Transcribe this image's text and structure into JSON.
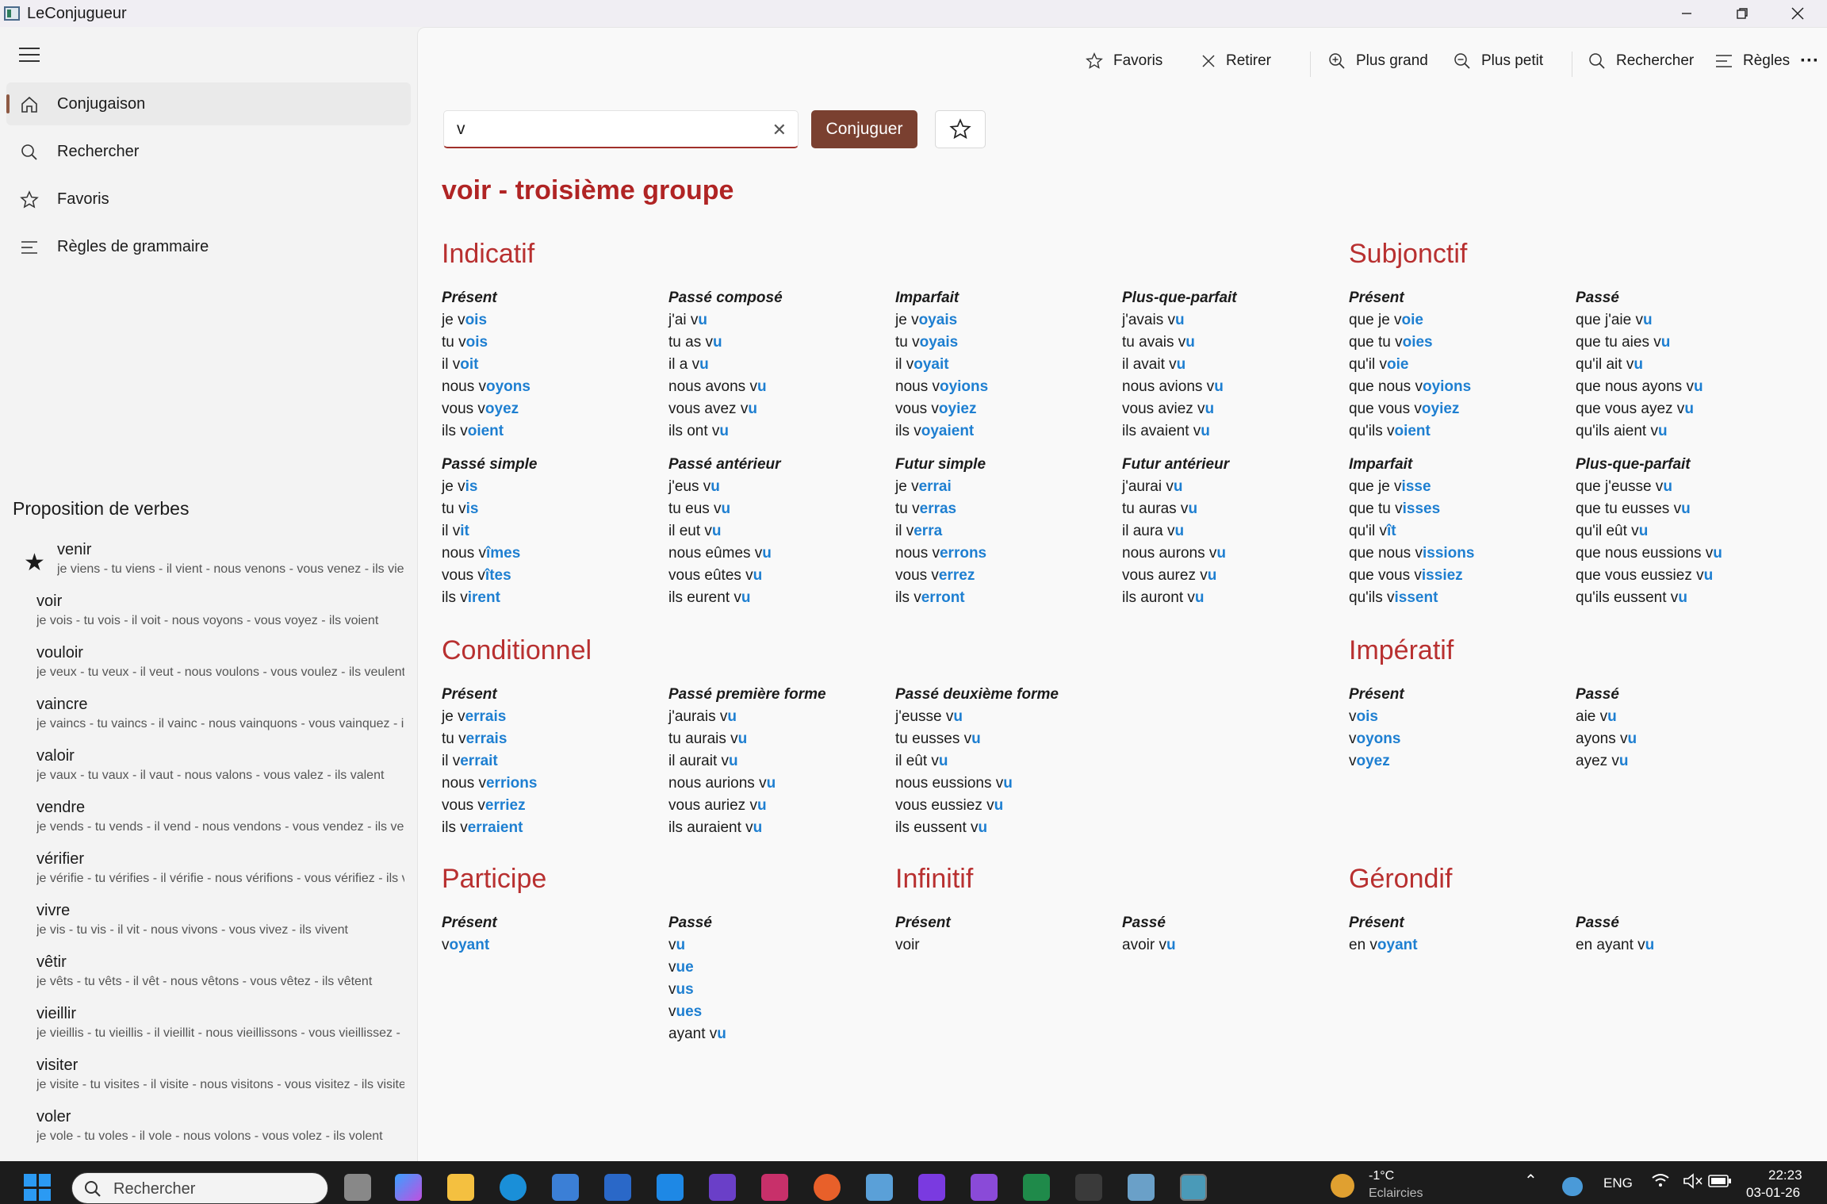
{
  "window": {
    "title": "LeConjugueur"
  },
  "nav": [
    {
      "label": "Conjugaison",
      "icon": "home-icon"
    },
    {
      "label": "Rechercher",
      "icon": "search-icon"
    },
    {
      "label": "Favoris",
      "icon": "star-icon"
    },
    {
      "label": "Règles de grammaire",
      "icon": "list-icon"
    }
  ],
  "suggestions": {
    "title": "Proposition de verbes",
    "items": [
      {
        "verb": "venir",
        "conj": "je viens - tu viens - il vient - nous venons - vous venez - ils viennent",
        "favorite": true
      },
      {
        "verb": "voir",
        "conj": "je vois - tu vois - il voit - nous voyons - vous voyez - ils voient"
      },
      {
        "verb": "vouloir",
        "conj": "je veux - tu veux - il veut - nous voulons - vous voulez - ils veulent"
      },
      {
        "verb": "vaincre",
        "conj": "je vaincs - tu vaincs - il vainc - nous vainquons - vous vainquez - ils vainquent"
      },
      {
        "verb": "valoir",
        "conj": "je vaux - tu vaux - il vaut - nous valons - vous valez - ils valent"
      },
      {
        "verb": "vendre",
        "conj": "je vends - tu vends - il vend - nous vendons - vous vendez - ils vendent"
      },
      {
        "verb": "vérifier",
        "conj": "je vérifie - tu vérifies - il vérifie - nous vérifions - vous vérifiez - ils vérifient"
      },
      {
        "verb": "vivre",
        "conj": "je vis - tu vis - il vit - nous vivons - vous vivez - ils vivent"
      },
      {
        "verb": "vêtir",
        "conj": "je vêts - tu vêts - il vêt - nous vêtons - vous vêtez - ils vêtent"
      },
      {
        "verb": "vieillir",
        "conj": "je vieillis - tu vieillis - il vieillit - nous vieillissons - vous vieillissez - ils vieillissent"
      },
      {
        "verb": "visiter",
        "conj": "je visite - tu visites - il visite - nous visitons - vous visitez - ils visitent"
      },
      {
        "verb": "voler",
        "conj": "je vole - tu voles - il vole - nous volons - vous volez - ils volent"
      }
    ]
  },
  "toolbar": {
    "favoris": "Favoris",
    "retirer": "Retirer",
    "plus_grand": "Plus grand",
    "plus_petit": "Plus petit",
    "rechercher": "Rechercher",
    "regles": "Règles",
    "more": "···"
  },
  "search": {
    "value": "v",
    "button": "Conjuguer"
  },
  "verb_title": "voir - troisième groupe",
  "sections": {
    "indicatif": "Indicatif",
    "subjonctif": "Subjonctif",
    "conditionnel": "Conditionnel",
    "imperatif": "Impératif",
    "participe": "Participe",
    "infinitif": "Infinitif",
    "gerondif": "Gérondif"
  },
  "tenses": [
    {
      "name": "Présent",
      "lines": [
        [
          "je v",
          "ois"
        ],
        [
          "tu v",
          "ois"
        ],
        [
          "il v",
          "oit"
        ],
        [
          "nous v",
          "oyons"
        ],
        [
          "vous v",
          "oyez"
        ],
        [
          "ils v",
          "oient"
        ]
      ]
    },
    {
      "name": "Passé composé",
      "lines": [
        [
          "j'ai v",
          "u"
        ],
        [
          "tu as v",
          "u"
        ],
        [
          "il a v",
          "u"
        ],
        [
          "nous avons v",
          "u"
        ],
        [
          "vous avez v",
          "u"
        ],
        [
          "ils ont v",
          "u"
        ]
      ]
    },
    {
      "name": "Imparfait",
      "lines": [
        [
          "je v",
          "oyais"
        ],
        [
          "tu v",
          "oyais"
        ],
        [
          "il v",
          "oyait"
        ],
        [
          "nous v",
          "oyions"
        ],
        [
          "vous v",
          "oyiez"
        ],
        [
          "ils v",
          "oyaient"
        ]
      ]
    },
    {
      "name": "Plus-que-parfait",
      "lines": [
        [
          "j'avais v",
          "u"
        ],
        [
          "tu avais v",
          "u"
        ],
        [
          "il avait v",
          "u"
        ],
        [
          "nous avions v",
          "u"
        ],
        [
          "vous aviez v",
          "u"
        ],
        [
          "ils avaient v",
          "u"
        ]
      ]
    },
    {
      "name": "Présent",
      "lines": [
        [
          "que je v",
          "oie"
        ],
        [
          "que tu v",
          "oies"
        ],
        [
          "qu'il v",
          "oie"
        ],
        [
          "que nous v",
          "oyions"
        ],
        [
          "que vous v",
          "oyiez"
        ],
        [
          "qu'ils v",
          "oient"
        ]
      ]
    },
    {
      "name": "Passé",
      "lines": [
        [
          "que j'aie v",
          "u"
        ],
        [
          "que tu aies v",
          "u"
        ],
        [
          "qu'il ait v",
          "u"
        ],
        [
          "que nous ayons v",
          "u"
        ],
        [
          "que vous ayez v",
          "u"
        ],
        [
          "qu'ils aient v",
          "u"
        ]
      ]
    },
    {
      "name": "Passé simple",
      "lines": [
        [
          "je v",
          "is"
        ],
        [
          "tu v",
          "is"
        ],
        [
          "il v",
          "it"
        ],
        [
          "nous v",
          "îmes"
        ],
        [
          "vous v",
          "îtes"
        ],
        [
          "ils v",
          "irent"
        ]
      ]
    },
    {
      "name": "Passé antérieur",
      "lines": [
        [
          "j'eus v",
          "u"
        ],
        [
          "tu eus v",
          "u"
        ],
        [
          "il eut v",
          "u"
        ],
        [
          "nous eûmes v",
          "u"
        ],
        [
          "vous eûtes v",
          "u"
        ],
        [
          "ils eurent v",
          "u"
        ]
      ]
    },
    {
      "name": "Futur simple",
      "lines": [
        [
          "je v",
          "errai"
        ],
        [
          "tu v",
          "erras"
        ],
        [
          "il v",
          "erra"
        ],
        [
          "nous v",
          "errons"
        ],
        [
          "vous v",
          "errez"
        ],
        [
          "ils v",
          "erront"
        ]
      ]
    },
    {
      "name": "Futur antérieur",
      "lines": [
        [
          "j'aurai v",
          "u"
        ],
        [
          "tu auras v",
          "u"
        ],
        [
          "il aura v",
          "u"
        ],
        [
          "nous aurons v",
          "u"
        ],
        [
          "vous aurez v",
          "u"
        ],
        [
          "ils auront v",
          "u"
        ]
      ]
    },
    {
      "name": "Imparfait",
      "lines": [
        [
          "que je v",
          "isse"
        ],
        [
          "que tu v",
          "isses"
        ],
        [
          "qu'il v",
          "ît"
        ],
        [
          "que nous v",
          "issions"
        ],
        [
          "que vous v",
          "issiez"
        ],
        [
          "qu'ils v",
          "issent"
        ]
      ]
    },
    {
      "name": "Plus-que-parfait",
      "lines": [
        [
          "que j'eusse v",
          "u"
        ],
        [
          "que tu eusses v",
          "u"
        ],
        [
          "qu'il eût v",
          "u"
        ],
        [
          "que nous eussions v",
          "u"
        ],
        [
          "que vous eussiez v",
          "u"
        ],
        [
          "qu'ils eussent v",
          "u"
        ]
      ]
    },
    {
      "name": "Présent",
      "lines": [
        [
          "je v",
          "errais"
        ],
        [
          "tu v",
          "errais"
        ],
        [
          "il v",
          "errait"
        ],
        [
          "nous v",
          "errions"
        ],
        [
          "vous v",
          "erriez"
        ],
        [
          "ils v",
          "erraient"
        ]
      ]
    },
    {
      "name": "Passé première forme",
      "lines": [
        [
          "j'aurais v",
          "u"
        ],
        [
          "tu aurais v",
          "u"
        ],
        [
          "il aurait v",
          "u"
        ],
        [
          "nous aurions v",
          "u"
        ],
        [
          "vous auriez v",
          "u"
        ],
        [
          "ils auraient v",
          "u"
        ]
      ]
    },
    {
      "name": "Passé deuxième forme",
      "lines": [
        [
          "j'eusse v",
          "u"
        ],
        [
          "tu eusses v",
          "u"
        ],
        [
          "il eût v",
          "u"
        ],
        [
          "nous eussions v",
          "u"
        ],
        [
          "vous eussiez v",
          "u"
        ],
        [
          "ils eussent v",
          "u"
        ]
      ]
    },
    {
      "name": "Présent",
      "lines": [
        [
          "v",
          "ois"
        ],
        [
          "v",
          "oyons"
        ],
        [
          "v",
          "oyez"
        ]
      ]
    },
    {
      "name": "Passé",
      "lines": [
        [
          "aie v",
          "u"
        ],
        [
          "ayons v",
          "u"
        ],
        [
          "ayez v",
          "u"
        ]
      ]
    },
    {
      "name": "Présent",
      "lines": [
        [
          "v",
          "oyant"
        ]
      ]
    },
    {
      "name": "Passé",
      "lines": [
        [
          "v",
          "u"
        ],
        [
          "v",
          "ue"
        ],
        [
          "v",
          "us"
        ],
        [
          "v",
          "ues"
        ],
        [
          "ayant v",
          "u"
        ]
      ]
    },
    {
      "name": "Présent",
      "lines": [
        [
          "voir",
          ""
        ]
      ]
    },
    {
      "name": "Passé",
      "lines": [
        [
          "avoir v",
          "u"
        ]
      ]
    },
    {
      "name": "Présent",
      "lines": [
        [
          "en v",
          "oyant"
        ]
      ]
    },
    {
      "name": "Passé",
      "lines": [
        [
          "en ayant v",
          "u"
        ]
      ]
    }
  ],
  "taskbar": {
    "search": "Rechercher",
    "weather_temp": "-1°C",
    "weather_desc": "Eclaircies",
    "lang": "ENG",
    "time": "22:23",
    "date": "03-01-26"
  }
}
